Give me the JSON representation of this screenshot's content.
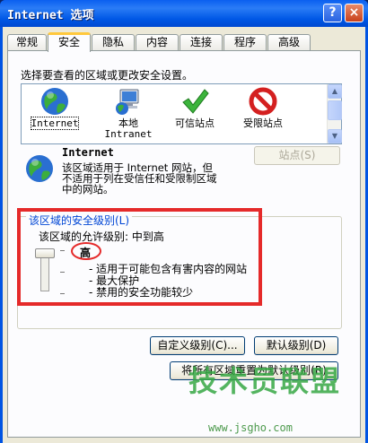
{
  "window": {
    "title": "Internet 选项",
    "help_label": "?",
    "close_label": "×"
  },
  "tabs": [
    {
      "label": "常规"
    },
    {
      "label": "安全"
    },
    {
      "label": "隐私"
    },
    {
      "label": "内容"
    },
    {
      "label": "连接"
    },
    {
      "label": "程序"
    },
    {
      "label": "高级"
    }
  ],
  "active_tab": "安全",
  "security": {
    "instruction": "选择要查看的区域或更改安全设置。",
    "zones": [
      {
        "label": "Internet",
        "icon": "globe-icon"
      },
      {
        "label": "本地\nIntranet",
        "icon": "intranet-icon"
      },
      {
        "label": "可信站点",
        "icon": "checkmark-icon"
      },
      {
        "label": "受限站点",
        "icon": "prohibited-icon"
      }
    ],
    "selected_zone": {
      "name": "Internet",
      "description": "该区域适用于 Internet 网站，但\n不适用于列在受信任和受限制区域\n中的网站。",
      "sites_button": "站点(S)"
    },
    "level_group": {
      "title": "该区域的安全级别(L)",
      "allowed": "该区域的允许级别: 中到高",
      "level_name": "高",
      "level_fraction": 1.0,
      "bullets": [
        "- 适用于可能包含有害内容的网站",
        "- 最大保护",
        "- 禁用的安全功能较少"
      ],
      "custom_button": "自定义级别(C)...",
      "default_button": "默认级别(D)"
    },
    "reset_all_button": "将所有区域重置为默认级别(R)"
  },
  "watermark": {
    "main": "技术员联盟",
    "url": "www.jsgho.com"
  }
}
